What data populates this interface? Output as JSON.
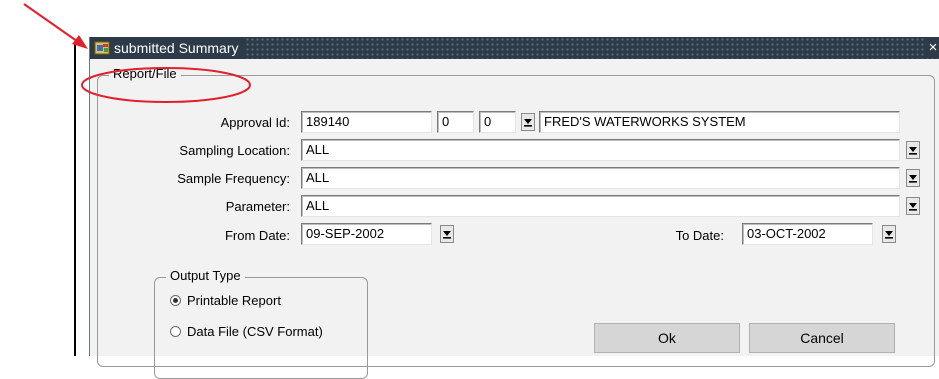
{
  "window": {
    "title": "submitted Summary",
    "close_symbol": "×"
  },
  "report_group": {
    "legend": "Report/File"
  },
  "fields": {
    "approval_id": {
      "label": "Approval Id:",
      "value": "189140",
      "part2": "0",
      "part3": "0",
      "description": "FRED'S WATERWORKS SYSTEM"
    },
    "sampling_location": {
      "label": "Sampling Location:",
      "value": "ALL"
    },
    "sample_frequency": {
      "label": "Sample Frequency:",
      "value": "ALL"
    },
    "parameter": {
      "label": "Parameter:",
      "value": "ALL"
    },
    "from_date": {
      "label": "From Date:",
      "value": "09-SEP-2002"
    },
    "to_date": {
      "label": "To Date:",
      "value": "03-OCT-2002"
    }
  },
  "output_group": {
    "legend": "Output Type",
    "options": [
      {
        "label": "Printable Report",
        "selected": true
      },
      {
        "label": "Data File (CSV Format)",
        "selected": false
      }
    ]
  },
  "buttons": {
    "ok": "Ok",
    "cancel": "Cancel"
  },
  "annotation": {
    "color": "#e0202a"
  },
  "icons": {
    "lov": "list-of-values-arrow-icon",
    "app": "oracle-forms-app-icon",
    "close": "close-icon"
  }
}
